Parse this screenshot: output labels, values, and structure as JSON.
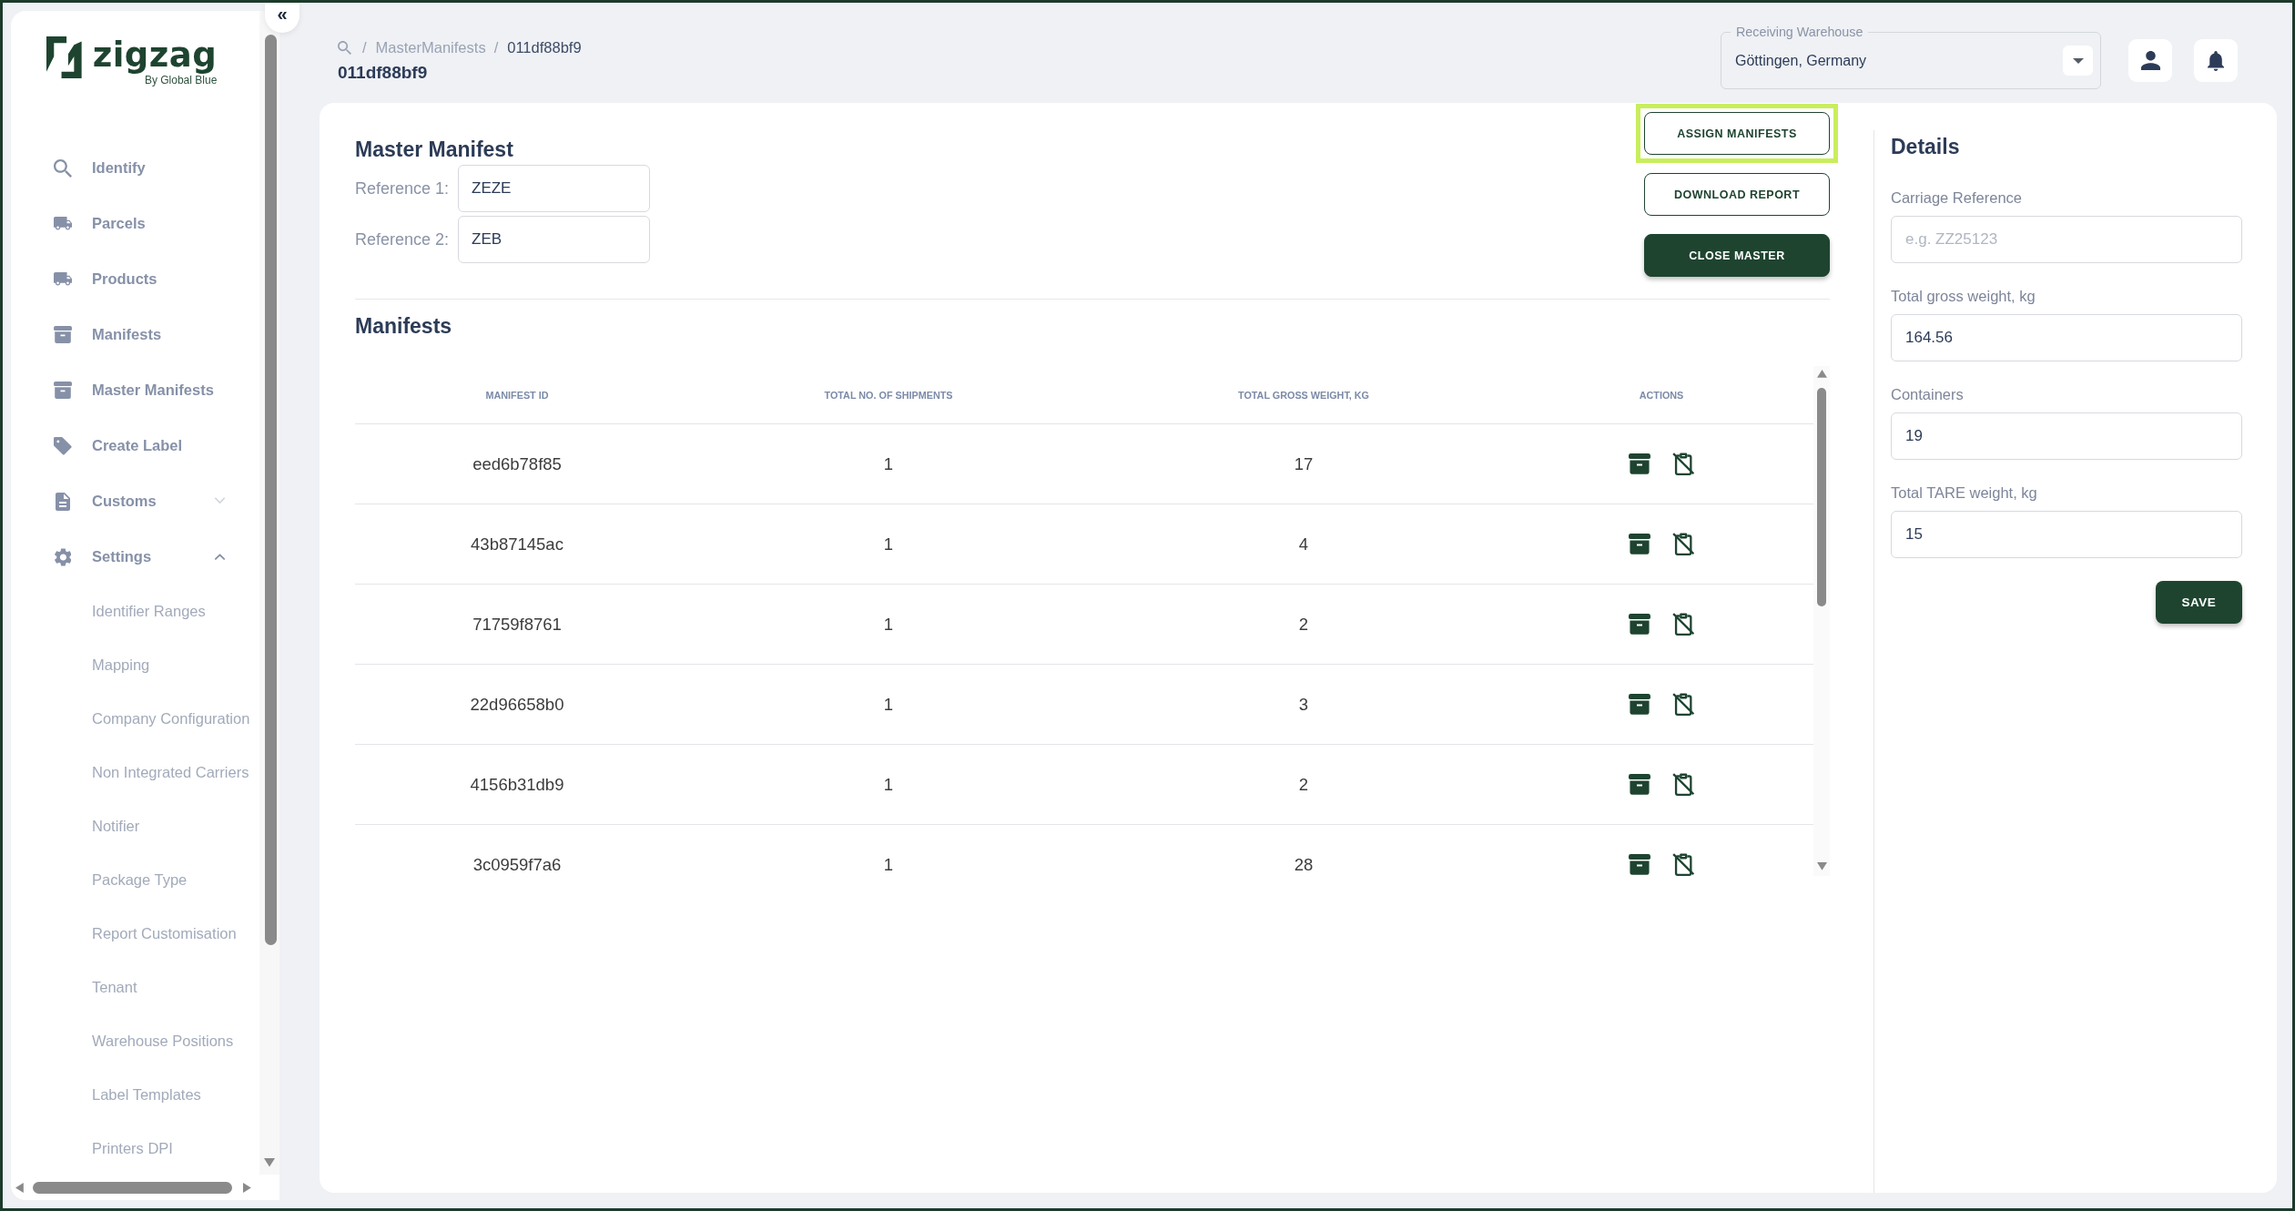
{
  "sidebar": {
    "collapse_button": "«",
    "logo": {
      "wordmark": "zigzag",
      "tagline": "By Global Blue"
    },
    "items": [
      {
        "label": "Identify",
        "selected": false
      },
      {
        "label": "Parcels",
        "selected": false
      },
      {
        "label": "Products",
        "selected": false
      },
      {
        "label": "Manifests",
        "selected": false
      },
      {
        "label": "Master Manifests",
        "selected": false
      },
      {
        "label": "Create Label",
        "selected": false
      },
      {
        "label": "Customs",
        "selected": false,
        "expanded": false
      },
      {
        "label": "Settings",
        "selected": false,
        "expanded": true,
        "children": [
          {
            "label": "Identifier Ranges",
            "selected": false
          },
          {
            "label": "Mapping",
            "selected": false
          },
          {
            "label": "Company Configuration",
            "selected": false
          },
          {
            "label": "Non Integrated Carriers",
            "selected": false
          },
          {
            "label": "Notifier",
            "selected": false
          },
          {
            "label": "Package Type",
            "selected": false
          },
          {
            "label": "Report Customisation",
            "selected": false
          },
          {
            "label": "Tenant",
            "selected": false
          },
          {
            "label": "Warehouse Positions",
            "selected": false
          },
          {
            "label": "Label Templates",
            "selected": false
          },
          {
            "label": "Printers DPI",
            "selected": false
          }
        ]
      }
    ]
  },
  "breadcrumb": [
    {
      "separator": "/",
      "label": "MasterManifests",
      "current": false
    },
    {
      "separator": "/",
      "label": "011df88bf9",
      "current": true
    }
  ],
  "page_title": "011df88bf9",
  "warehouse_select": {
    "label": "Receiving Warehouse",
    "value": "Göttingen, Germany"
  },
  "master_manifest": {
    "title": "Master Manifest",
    "references": [
      {
        "label": "Reference 1:",
        "value": "ZEZE"
      },
      {
        "label": "Reference 2:",
        "value": "ZEB"
      }
    ],
    "actions": [
      {
        "label": "ASSIGN MANIFESTS",
        "kind": "outline",
        "focused": true
      },
      {
        "label": "DOWNLOAD REPORT",
        "kind": "outline",
        "focused": false
      },
      {
        "label": "CLOSE MASTER",
        "kind": "filled",
        "focused": false
      }
    ]
  },
  "manifests": {
    "title": "Manifests",
    "columns": [
      "MANIFEST ID",
      "TOTAL NO. OF SHIPMENTS",
      "TOTAL GROSS WEIGHT, KG",
      "ACTIONS"
    ],
    "rows": [
      {
        "cells": [
          "eed6b78f85",
          "1",
          "17"
        ]
      },
      {
        "cells": [
          "43b87145ac",
          "1",
          "4"
        ]
      },
      {
        "cells": [
          "71759f8761",
          "1",
          "2"
        ]
      },
      {
        "cells": [
          "22d96658b0",
          "1",
          "3"
        ]
      },
      {
        "cells": [
          "4156b31db9",
          "1",
          "2"
        ]
      },
      {
        "cells": [
          "3c0959f7a6",
          "1",
          "28"
        ]
      }
    ]
  },
  "details": {
    "title": "Details",
    "fields": [
      {
        "label": "Carriage Reference",
        "placeholder": "e.g. ZZ25123"
      },
      {
        "label": "Total gross weight, kg",
        "value": "164.56"
      },
      {
        "label": "Containers",
        "value": "19"
      },
      {
        "label": "Total TARE weight, kg",
        "value": "15"
      }
    ],
    "save_button": "SAVE"
  }
}
